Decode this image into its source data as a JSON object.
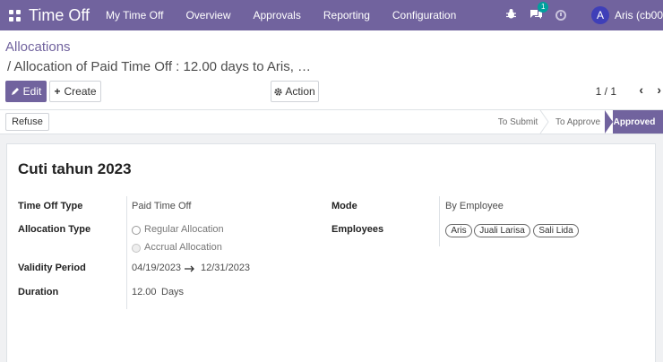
{
  "navbar": {
    "brand": "Time Off",
    "menu": [
      "My Time Off",
      "Overview",
      "Approvals",
      "Reporting",
      "Configuration"
    ],
    "chat_count": "1",
    "user_initial": "A",
    "user_name": "Aris (cb00"
  },
  "breadcrumb": {
    "root": "Allocations",
    "current": "/ Allocation of Paid Time Off : 12.00 days to Aris, …"
  },
  "buttons": {
    "edit": "Edit",
    "create": "Create",
    "action": "Action",
    "refuse": "Refuse"
  },
  "pager": {
    "value": "1 / 1"
  },
  "statusbar": {
    "stages": [
      "To Submit",
      "To Approve"
    ],
    "active": "Approved"
  },
  "form": {
    "title": "Cuti tahun 2023",
    "time_off_type_label": "Time Off Type",
    "time_off_type_value": "Paid Time Off",
    "allocation_type_label": "Allocation Type",
    "allocation_options": [
      "Regular Allocation",
      "Accrual Allocation"
    ],
    "validity_label": "Validity Period",
    "validity_start": "04/19/2023",
    "validity_end": "12/31/2023",
    "duration_label": "Duration",
    "duration_value": "12.00",
    "duration_unit": "Days",
    "mode_label": "Mode",
    "mode_value": "By Employee",
    "employees_label": "Employees",
    "employees": [
      "Aris",
      "Juali Larisa",
      "Sali Lida"
    ]
  }
}
